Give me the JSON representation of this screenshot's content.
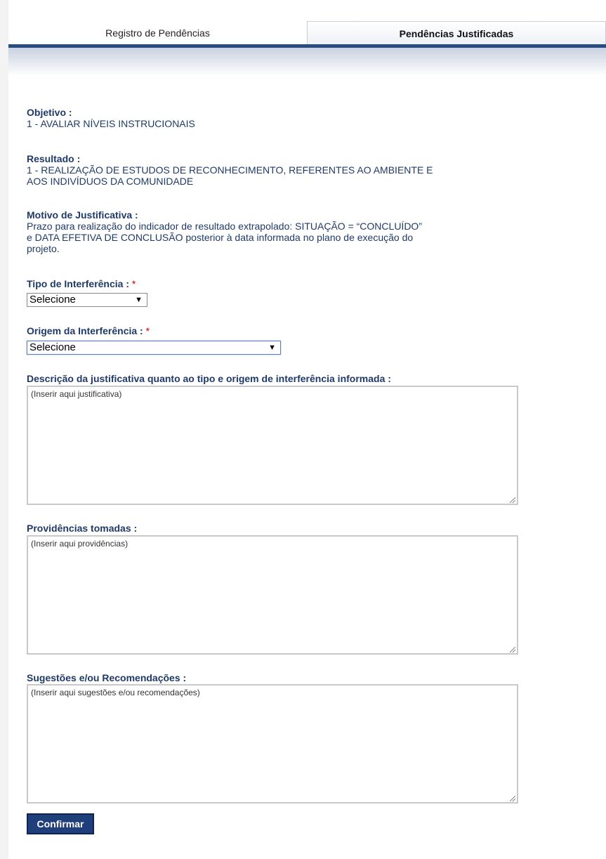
{
  "tabs": [
    {
      "label": "Registro de Pendências",
      "active": false
    },
    {
      "label": "Pendências Justificadas",
      "active": true
    }
  ],
  "objetivo": {
    "label": "Objetivo :",
    "value": "1 - AVALIAR NÍVEIS INSTRUCIONAIS"
  },
  "resultado": {
    "label": "Resultado :",
    "value_line1": "1 - REALIZAÇÃO DE ESTUDOS DE RECONHECIMENTO, REFERENTES AO AMBIENTE E",
    "value_line2": "AOS INDIVÍDUOS DA COMUNIDADE"
  },
  "motivo": {
    "label": "Motivo de Justificativa :",
    "line1": "Prazo para realização do indicador de resultado extrapolado: SITUAÇÃO = “CONCLUÍDO”",
    "line2": "e DATA EFETIVA DE CONCLUSÃO posterior à data informada no plano de execução do",
    "line3": "projeto."
  },
  "tipo_interferencia": {
    "label": "Tipo de Interferência :",
    "required_mark": "*",
    "selected": "Selecione"
  },
  "origem_interferencia": {
    "label": "Origem da Interferência :",
    "required_mark": "*",
    "selected": "Selecione"
  },
  "descricao": {
    "label": "Descrição da justificativa quanto ao tipo e origem de interferência informada :",
    "text": "(Inserir aqui justificativa)"
  },
  "providencias": {
    "label": "Providências tomadas :",
    "text": "(Inserir aqui providências)"
  },
  "sugestoes": {
    "label": "Sugestões e/ou Recomendações :",
    "text": "(Inserir aqui sugestões e/ou recomendações)"
  },
  "confirm_label": "Confirmar",
  "colors": {
    "label_blue": "#1f3a68",
    "tab_bar": "#2a4a82",
    "button_bg": "#1f3e7a",
    "required": "#cc0000"
  },
  "icons": {
    "dropdown": "triangle-down-icon",
    "resize": "resize-grip-icon"
  }
}
